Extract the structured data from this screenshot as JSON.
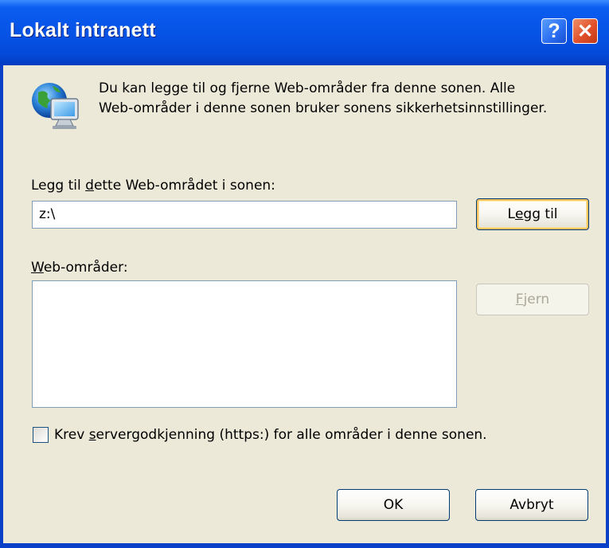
{
  "window": {
    "title": "Lokalt intranett",
    "help_button": "?",
    "close_button": "✕"
  },
  "intro": {
    "icon": "globe-computer-icon",
    "line1": "Du kan legge til og fjerne Web-områder fra denne sonen. Alle",
    "line2": "Web-områder i denne sonen bruker sonens sikkerhetsinnstillinger."
  },
  "add_site": {
    "label_pre": "Legg til ",
    "label_accel": "d",
    "label_post": "ette Web-området i sonen:",
    "value": "z:\\",
    "button_pre": "L",
    "button_accel": "e",
    "button_post": "gg til"
  },
  "sites": {
    "label_accel": "W",
    "label_post": "eb-områder:",
    "items": [],
    "remove_pre": "",
    "remove_accel": "F",
    "remove_post": "jern"
  },
  "require_https": {
    "checked": false,
    "label_pre": "Krev ",
    "label_accel": "s",
    "label_post": "ervergodkjenning (https:) for alle områder i denne sonen."
  },
  "footer": {
    "ok_label": "OK",
    "cancel_label": "Avbryt"
  },
  "colors": {
    "titlebar": "#0654e6",
    "dialog_bg": "#ece9d8",
    "close_button": "#e0502a",
    "default_button_highlight": "#f6c25d"
  }
}
